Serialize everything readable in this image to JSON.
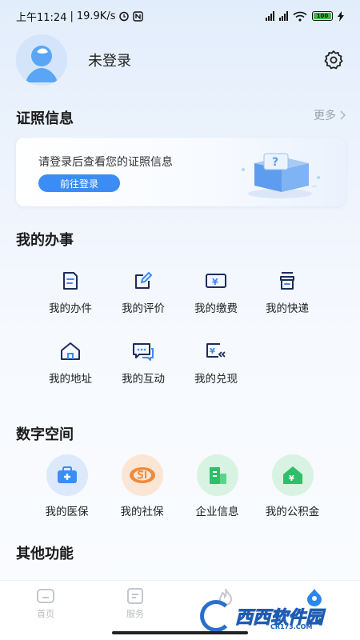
{
  "status_bar": {
    "time": "上午11:24",
    "speed": "19.9K/s",
    "battery": "100"
  },
  "user": {
    "name": "未登录"
  },
  "cert_section": {
    "title": "证照信息",
    "more": "更多",
    "prompt": "请登录后查看您的证照信息",
    "login_button": "前往登录"
  },
  "tasks_section": {
    "title": "我的办事",
    "items": [
      {
        "label": "我的办件",
        "icon": "document-icon"
      },
      {
        "label": "我的评价",
        "icon": "edit-icon"
      },
      {
        "label": "我的缴费",
        "icon": "yuan-bill-icon"
      },
      {
        "label": "我的快递",
        "icon": "package-icon"
      },
      {
        "label": "我的地址",
        "icon": "house-icon"
      },
      {
        "label": "我的互动",
        "icon": "chat-icon"
      },
      {
        "label": "我的兑现",
        "icon": "cash-return-icon"
      }
    ]
  },
  "digital_section": {
    "title": "数字空间",
    "items": [
      {
        "label": "我的医保",
        "icon": "medical-kit-icon",
        "color": "#3b8cf5"
      },
      {
        "label": "我的社保",
        "icon": "social-security-icon",
        "color": "#f08a3c"
      },
      {
        "label": "企业信息",
        "icon": "building-icon",
        "color": "#2fbf6a"
      },
      {
        "label": "我的公积金",
        "icon": "housing-fund-icon",
        "color": "#2fbf6a"
      }
    ]
  },
  "other_section": {
    "title": "其他功能"
  },
  "bottom_nav": {
    "items": [
      {
        "label": "首页",
        "icon": "home-icon"
      },
      {
        "label": "服务",
        "icon": "service-icon"
      },
      {
        "label": "",
        "icon": "flame-icon"
      },
      {
        "label": "",
        "icon": "profile-drop-icon"
      }
    ]
  },
  "watermark": {
    "text": "西西软件园",
    "sub": "CR173.COM"
  }
}
